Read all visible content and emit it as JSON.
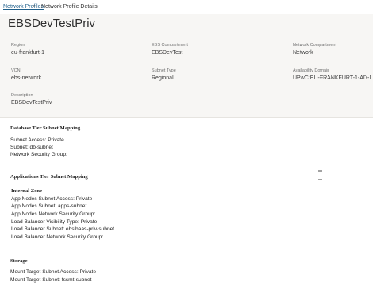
{
  "breadcrumb": {
    "link": "Network Profiles",
    "separator": ">",
    "current": "Network Profile Details"
  },
  "profile": {
    "title": "EBSDevTestPriv",
    "fields": {
      "region_label": "Region",
      "region_value": "eu-frankfurt-1",
      "ebs_compartment_label": "EBS Compartment",
      "ebs_compartment_value": "EBSDevTest",
      "network_compartment_label": "Network Compartment",
      "network_compartment_value": "Network",
      "vcn_label": "VCN",
      "vcn_value": "ebs-network",
      "subnet_type_label": "Subnet Type",
      "subnet_type_value": "Regional",
      "availability_domain_label": "Availability Domain",
      "availability_domain_value": "UPwC:EU-FRANKFURT-1-AD-1",
      "description_label": "Description",
      "description_value": "EBSDevTestPriv"
    }
  },
  "database_tier": {
    "title": "Database Tier Subnet Mapping",
    "lines": [
      "Subnet Access: Private",
      "Subnet: db-subnet",
      "Network Security Group:"
    ]
  },
  "applications_tier": {
    "title": "Applications Tier Subnet Mapping",
    "internal_zone_title": "Internal Zone",
    "lines": [
      "App Nodes Subnet Access: Private",
      "App Nodes Subnet: apps-subnet",
      "App Nodes Network Security Group:",
      "Load Balancer Visibility Type: Private",
      "Load Balancer Subnet: ebslbaas-priv-subnet",
      "Load Balancer Network Security Group:"
    ]
  },
  "storage": {
    "title": "Storage",
    "lines": [
      "Mount Target Subnet Access: Private",
      "Mount Target Subnet: fssmt-subnet"
    ]
  }
}
